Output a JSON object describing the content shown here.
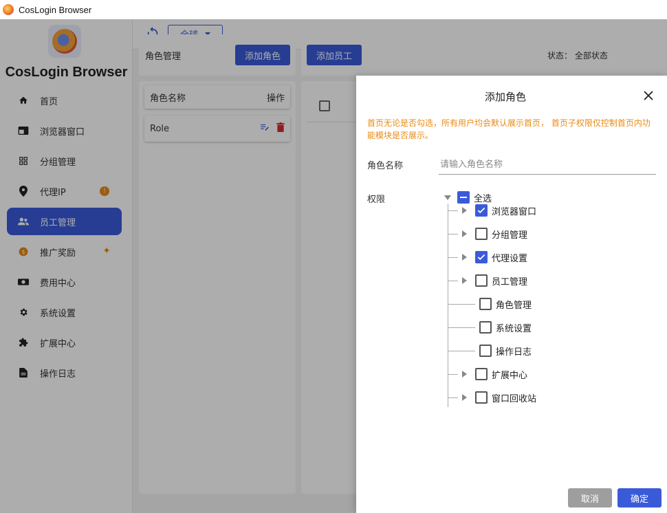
{
  "window": {
    "title": "CosLogin Browser"
  },
  "sidebar": {
    "brand": "CosLogin Browser",
    "items": [
      {
        "label": "首页",
        "icon": "home-icon"
      },
      {
        "label": "浏览器窗口",
        "icon": "browser-window-icon"
      },
      {
        "label": "分组管理",
        "icon": "grid-icon"
      },
      {
        "label": "代理IP",
        "icon": "location-pin-icon",
        "badge": "!"
      },
      {
        "label": "员工管理",
        "icon": "people-icon",
        "active": true
      },
      {
        "label": "推广奖励",
        "icon": "coin-icon",
        "badge": "sparkle"
      },
      {
        "label": "费用中心",
        "icon": "wallet-icon"
      },
      {
        "label": "系统设置",
        "icon": "gear-icon"
      },
      {
        "label": "扩展中心",
        "icon": "puzzle-icon"
      },
      {
        "label": "操作日志",
        "icon": "document-icon"
      }
    ]
  },
  "topbar": {
    "region": "全球"
  },
  "role_panel": {
    "title": "角色管理",
    "add_button": "添加角色",
    "columns": {
      "name": "角色名称",
      "actions": "操作"
    },
    "rows": [
      {
        "name": "Role"
      }
    ]
  },
  "staff_panel": {
    "add_button": "添加员工",
    "status_label": "状态： 全部状态"
  },
  "dialog": {
    "title": "添加角色",
    "note": "首页无论是否勾选，所有用户均会默认展示首页， 首页子权限仅控制首页内功能模块是否展示。",
    "name_label": "角色名称",
    "name_placeholder": "请输入角色名称",
    "name_value": "",
    "perm_label": "权限",
    "select_all": "全选",
    "permissions": [
      {
        "label": "浏览器窗口",
        "checked": true,
        "expandable": true
      },
      {
        "label": "分组管理",
        "checked": false,
        "expandable": true
      },
      {
        "label": "代理设置",
        "checked": true,
        "expandable": true
      },
      {
        "label": "员工管理",
        "checked": false,
        "expandable": true
      },
      {
        "label": "角色管理",
        "checked": false,
        "expandable": false
      },
      {
        "label": "系统设置",
        "checked": false,
        "expandable": false
      },
      {
        "label": "操作日志",
        "checked": false,
        "expandable": false
      },
      {
        "label": "扩展中心",
        "checked": false,
        "expandable": true
      },
      {
        "label": "窗口回收站",
        "checked": false,
        "expandable": true
      }
    ],
    "cancel": "取消",
    "confirm": "确定"
  },
  "colors": {
    "accent": "#3a5bd9",
    "warning": "#e88a16"
  }
}
